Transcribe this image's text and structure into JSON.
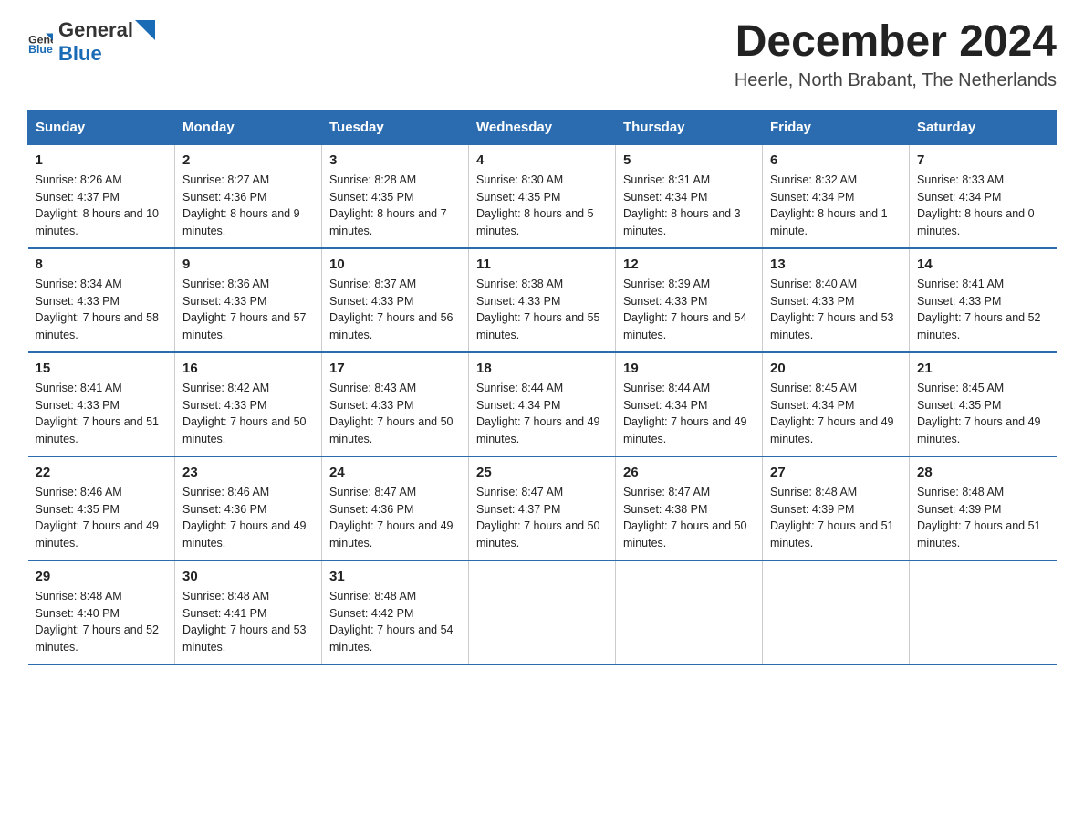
{
  "header": {
    "logo_general": "General",
    "logo_blue": "Blue",
    "month_year": "December 2024",
    "location": "Heerle, North Brabant, The Netherlands"
  },
  "weekdays": [
    "Sunday",
    "Monday",
    "Tuesday",
    "Wednesday",
    "Thursday",
    "Friday",
    "Saturday"
  ],
  "weeks": [
    [
      {
        "day": "1",
        "sunrise": "8:26 AM",
        "sunset": "4:37 PM",
        "daylight": "8 hours and 10 minutes."
      },
      {
        "day": "2",
        "sunrise": "8:27 AM",
        "sunset": "4:36 PM",
        "daylight": "8 hours and 9 minutes."
      },
      {
        "day": "3",
        "sunrise": "8:28 AM",
        "sunset": "4:35 PM",
        "daylight": "8 hours and 7 minutes."
      },
      {
        "day": "4",
        "sunrise": "8:30 AM",
        "sunset": "4:35 PM",
        "daylight": "8 hours and 5 minutes."
      },
      {
        "day": "5",
        "sunrise": "8:31 AM",
        "sunset": "4:34 PM",
        "daylight": "8 hours and 3 minutes."
      },
      {
        "day": "6",
        "sunrise": "8:32 AM",
        "sunset": "4:34 PM",
        "daylight": "8 hours and 1 minute."
      },
      {
        "day": "7",
        "sunrise": "8:33 AM",
        "sunset": "4:34 PM",
        "daylight": "8 hours and 0 minutes."
      }
    ],
    [
      {
        "day": "8",
        "sunrise": "8:34 AM",
        "sunset": "4:33 PM",
        "daylight": "7 hours and 58 minutes."
      },
      {
        "day": "9",
        "sunrise": "8:36 AM",
        "sunset": "4:33 PM",
        "daylight": "7 hours and 57 minutes."
      },
      {
        "day": "10",
        "sunrise": "8:37 AM",
        "sunset": "4:33 PM",
        "daylight": "7 hours and 56 minutes."
      },
      {
        "day": "11",
        "sunrise": "8:38 AM",
        "sunset": "4:33 PM",
        "daylight": "7 hours and 55 minutes."
      },
      {
        "day": "12",
        "sunrise": "8:39 AM",
        "sunset": "4:33 PM",
        "daylight": "7 hours and 54 minutes."
      },
      {
        "day": "13",
        "sunrise": "8:40 AM",
        "sunset": "4:33 PM",
        "daylight": "7 hours and 53 minutes."
      },
      {
        "day": "14",
        "sunrise": "8:41 AM",
        "sunset": "4:33 PM",
        "daylight": "7 hours and 52 minutes."
      }
    ],
    [
      {
        "day": "15",
        "sunrise": "8:41 AM",
        "sunset": "4:33 PM",
        "daylight": "7 hours and 51 minutes."
      },
      {
        "day": "16",
        "sunrise": "8:42 AM",
        "sunset": "4:33 PM",
        "daylight": "7 hours and 50 minutes."
      },
      {
        "day": "17",
        "sunrise": "8:43 AM",
        "sunset": "4:33 PM",
        "daylight": "7 hours and 50 minutes."
      },
      {
        "day": "18",
        "sunrise": "8:44 AM",
        "sunset": "4:34 PM",
        "daylight": "7 hours and 49 minutes."
      },
      {
        "day": "19",
        "sunrise": "8:44 AM",
        "sunset": "4:34 PM",
        "daylight": "7 hours and 49 minutes."
      },
      {
        "day": "20",
        "sunrise": "8:45 AM",
        "sunset": "4:34 PM",
        "daylight": "7 hours and 49 minutes."
      },
      {
        "day": "21",
        "sunrise": "8:45 AM",
        "sunset": "4:35 PM",
        "daylight": "7 hours and 49 minutes."
      }
    ],
    [
      {
        "day": "22",
        "sunrise": "8:46 AM",
        "sunset": "4:35 PM",
        "daylight": "7 hours and 49 minutes."
      },
      {
        "day": "23",
        "sunrise": "8:46 AM",
        "sunset": "4:36 PM",
        "daylight": "7 hours and 49 minutes."
      },
      {
        "day": "24",
        "sunrise": "8:47 AM",
        "sunset": "4:36 PM",
        "daylight": "7 hours and 49 minutes."
      },
      {
        "day": "25",
        "sunrise": "8:47 AM",
        "sunset": "4:37 PM",
        "daylight": "7 hours and 50 minutes."
      },
      {
        "day": "26",
        "sunrise": "8:47 AM",
        "sunset": "4:38 PM",
        "daylight": "7 hours and 50 minutes."
      },
      {
        "day": "27",
        "sunrise": "8:48 AM",
        "sunset": "4:39 PM",
        "daylight": "7 hours and 51 minutes."
      },
      {
        "day": "28",
        "sunrise": "8:48 AM",
        "sunset": "4:39 PM",
        "daylight": "7 hours and 51 minutes."
      }
    ],
    [
      {
        "day": "29",
        "sunrise": "8:48 AM",
        "sunset": "4:40 PM",
        "daylight": "7 hours and 52 minutes."
      },
      {
        "day": "30",
        "sunrise": "8:48 AM",
        "sunset": "4:41 PM",
        "daylight": "7 hours and 53 minutes."
      },
      {
        "day": "31",
        "sunrise": "8:48 AM",
        "sunset": "4:42 PM",
        "daylight": "7 hours and 54 minutes."
      },
      null,
      null,
      null,
      null
    ]
  ],
  "labels": {
    "sunrise": "Sunrise:",
    "sunset": "Sunset:",
    "daylight": "Daylight:"
  }
}
